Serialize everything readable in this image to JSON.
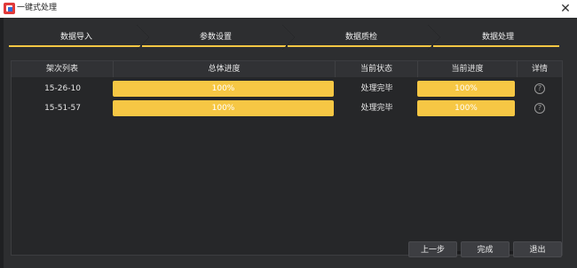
{
  "window": {
    "title": "一键式处理",
    "close_glyph": "✕"
  },
  "steps": [
    "数据导入",
    "参数设置",
    "数据质检",
    "数据处理"
  ],
  "table": {
    "headers": [
      "架次列表",
      "总体进度",
      "当前状态",
      "当前进度",
      "详情"
    ],
    "rows": [
      {
        "name": "15-26-10",
        "overall": "100%",
        "status": "处理完毕",
        "current": "100%",
        "detail_icon": "help-icon"
      },
      {
        "name": "15-51-57",
        "overall": "100%",
        "status": "处理完毕",
        "current": "100%",
        "detail_icon": "help-icon"
      }
    ]
  },
  "buttons": {
    "prev": "上一步",
    "finish": "完成",
    "exit": "退出"
  },
  "colors": {
    "accent": "#f6c744",
    "background": "#2d2e30",
    "header": "#313235"
  }
}
